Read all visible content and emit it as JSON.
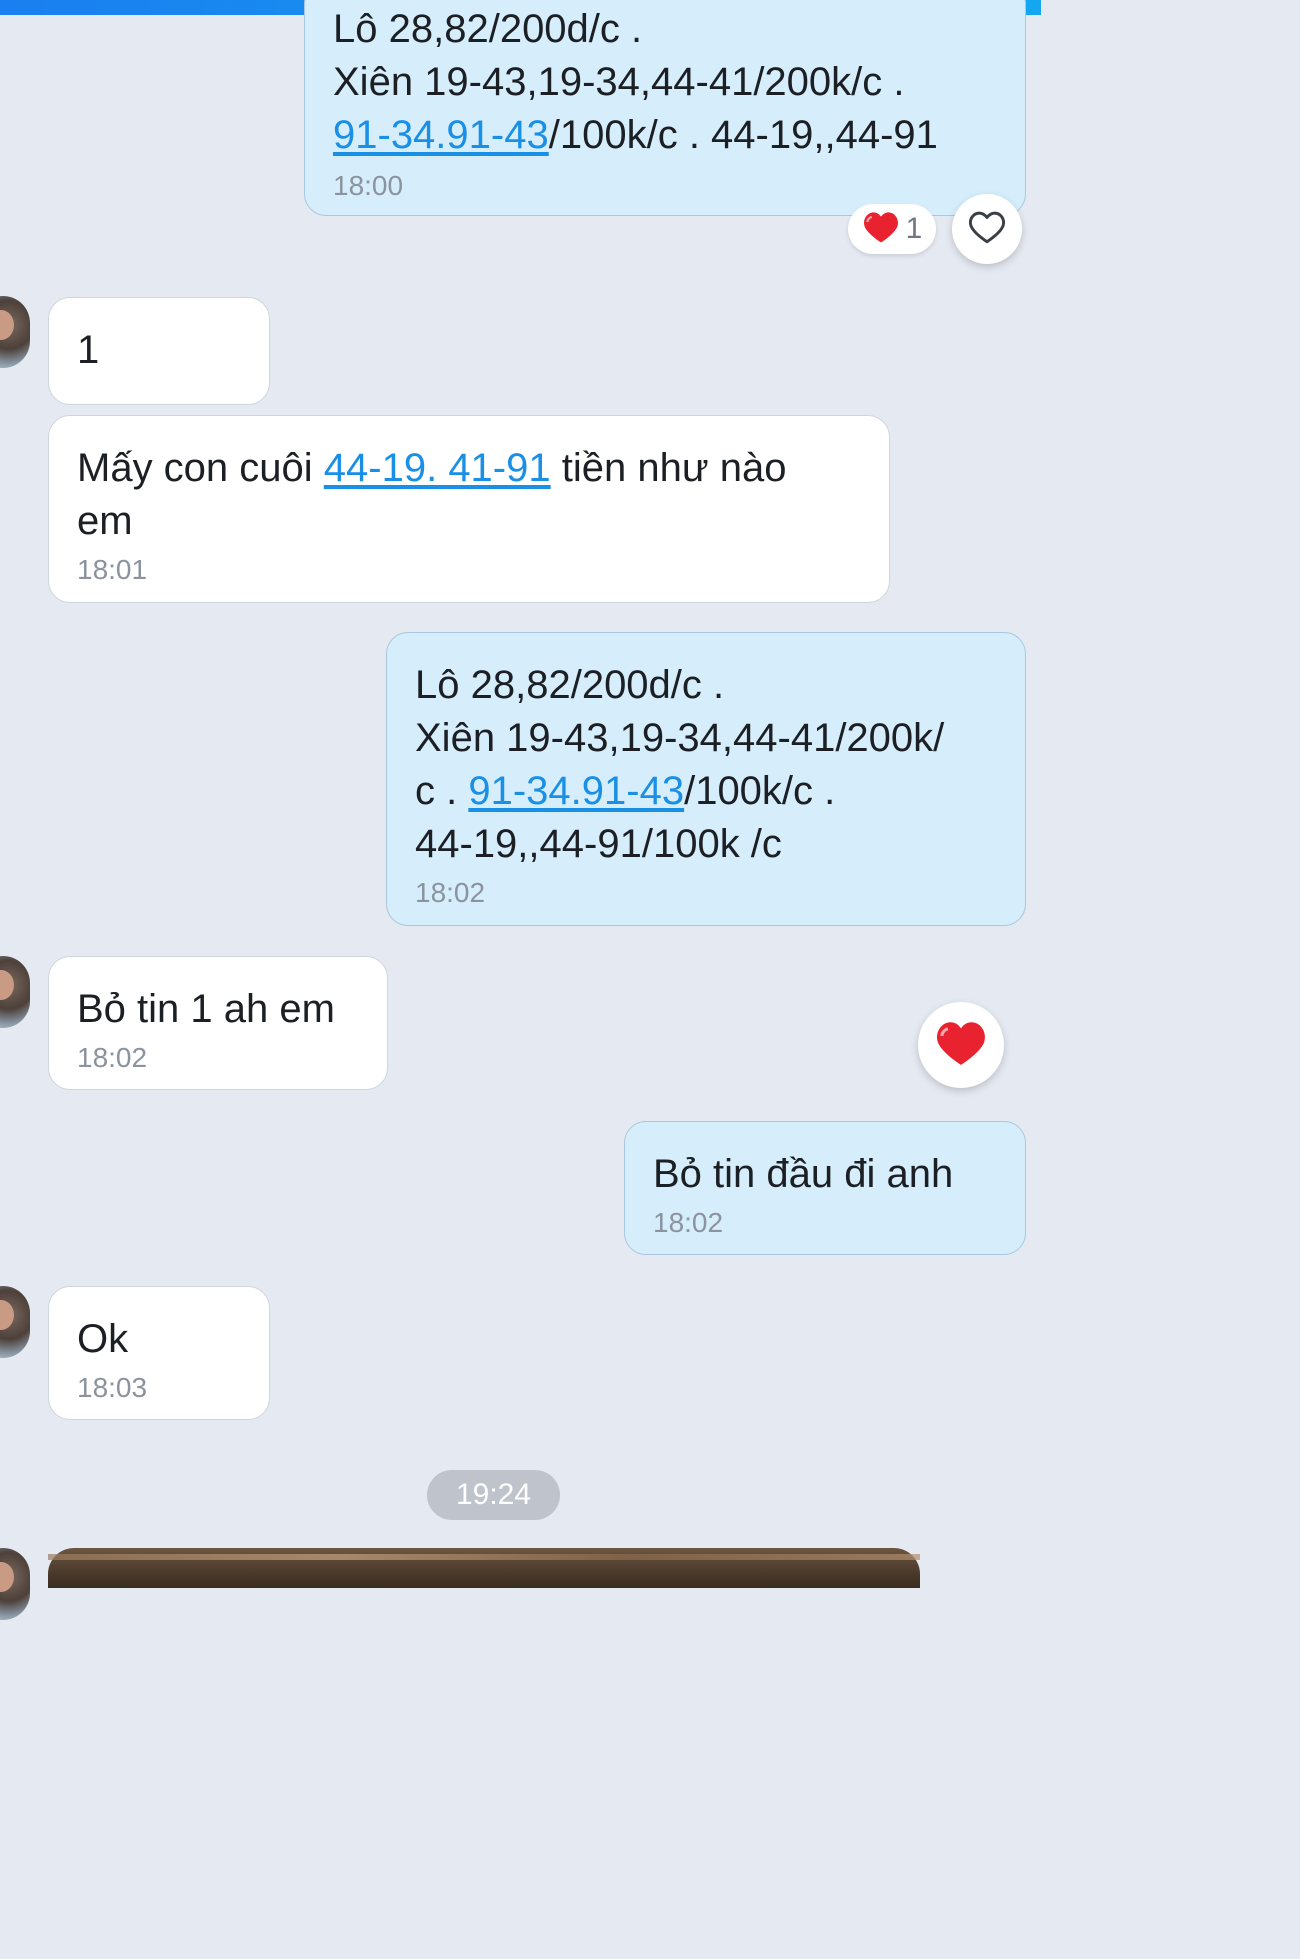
{
  "messages": [
    {
      "side": "mine",
      "lines": [
        [
          {
            "t": "Lô 28,82/200d/c ."
          }
        ],
        [
          {
            "t": "Xiên 19-43,19-34,44-41/200k/c ."
          }
        ],
        [
          {
            "t": "91-34.91-43",
            "link": true
          },
          {
            "t": "/100k/c . 44-19,,44-91"
          }
        ]
      ],
      "time": "18:00",
      "reactions": {
        "emoji": "heart",
        "count": "1"
      }
    },
    {
      "side": "theirs",
      "lines": [
        [
          {
            "t": "1"
          }
        ]
      ],
      "time": ""
    },
    {
      "side": "theirs",
      "lines": [
        [
          {
            "t": "Mấy con cuôi "
          },
          {
            "t": "44-19. 41-91",
            "link": true
          },
          {
            "t": " tiền như nào"
          }
        ],
        [
          {
            "t": "em"
          }
        ]
      ],
      "time": "18:01"
    },
    {
      "side": "mine",
      "lines": [
        [
          {
            "t": "Lô 28,82/200d/c ."
          }
        ],
        [
          {
            "t": "Xiên 19-43,19-34,44-41/200k/"
          }
        ],
        [
          {
            "t": "c . "
          },
          {
            "t": "91-34.91-43",
            "link": true
          },
          {
            "t": "/100k/c ."
          }
        ],
        [
          {
            "t": "44-19,,44-91/100k /c"
          }
        ]
      ],
      "time": "18:02"
    },
    {
      "side": "theirs",
      "lines": [
        [
          {
            "t": "Bỏ tin 1 ah em"
          }
        ]
      ],
      "time": "18:02"
    },
    {
      "side": "mine",
      "lines": [
        [
          {
            "t": "Bỏ tin đầu đi anh"
          }
        ]
      ],
      "time": "18:02"
    },
    {
      "side": "theirs",
      "lines": [
        [
          {
            "t": "Ok"
          }
        ]
      ],
      "time": "18:03"
    }
  ],
  "date_divider": "19:24",
  "icons": {
    "heart_outline": "heart-outline-icon",
    "heart_filled": "heart-icon"
  },
  "colors": {
    "link": "#1a8fe6",
    "my_bubble": "#d6eefc",
    "their_bubble": "#ffffff",
    "background": "#e5e9f1",
    "heart": "#e8232f"
  }
}
